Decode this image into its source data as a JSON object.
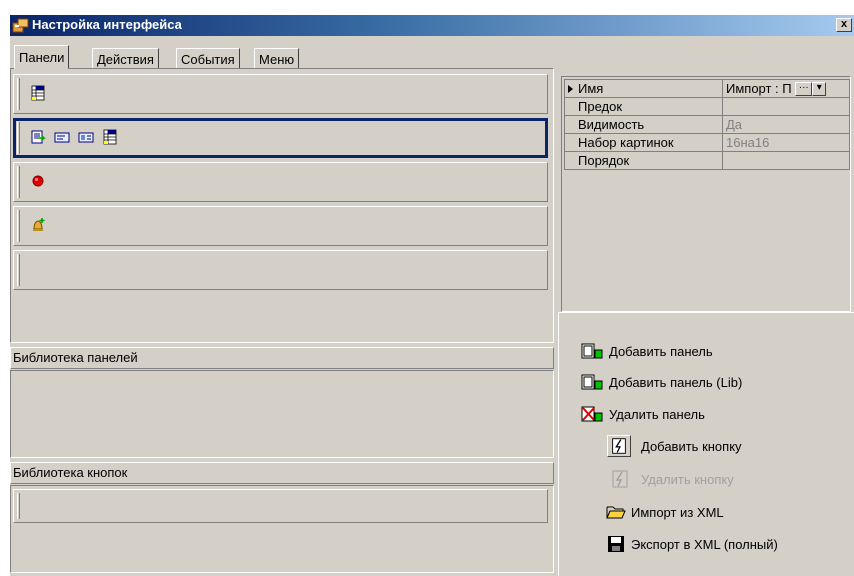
{
  "window": {
    "title": "Настройка интерфейса",
    "close_label": "x"
  },
  "tabs": [
    {
      "label": "Панели",
      "active": true
    },
    {
      "label": "Действия",
      "active": false
    },
    {
      "label": "События",
      "active": false
    },
    {
      "label": "Меню",
      "active": false
    }
  ],
  "panels": {
    "bands": [
      {
        "icons": [
          "panel-table-icon"
        ]
      },
      {
        "icons": [
          "import-icon",
          "card-icon",
          "id-card-icon",
          "panel-table-icon"
        ],
        "selected": true
      },
      {
        "icons": [
          "red-circle-icon"
        ]
      },
      {
        "icons": [
          "bell-add-icon"
        ]
      },
      {
        "icons": []
      }
    ]
  },
  "library_panels": {
    "label": "Библиотека панелей"
  },
  "library_buttons": {
    "label": "Библиотека кнопок"
  },
  "properties": {
    "rows": [
      {
        "key": "Имя",
        "value": "Импорт : П",
        "editable": true,
        "current": true
      },
      {
        "key": "Предок",
        "value": ""
      },
      {
        "key": "Видимость",
        "value": "Да",
        "disabled": true
      },
      {
        "key": "Набор картинок",
        "value": "16на16",
        "disabled": true
      },
      {
        "key": "Порядок",
        "value": ""
      }
    ],
    "ellipsis_label": "···",
    "dropdown_label": "▾"
  },
  "actions": {
    "add_panel": "Добавить панель",
    "add_panel_lib": "Добавить панель (Lib)",
    "delete_panel": "Удалить панель",
    "add_button": "Добавить кнопку",
    "delete_button": "Удалить кнопку",
    "import_xml": "Импорт из XML",
    "export_xml": "Экспорт в XML (полный)"
  }
}
